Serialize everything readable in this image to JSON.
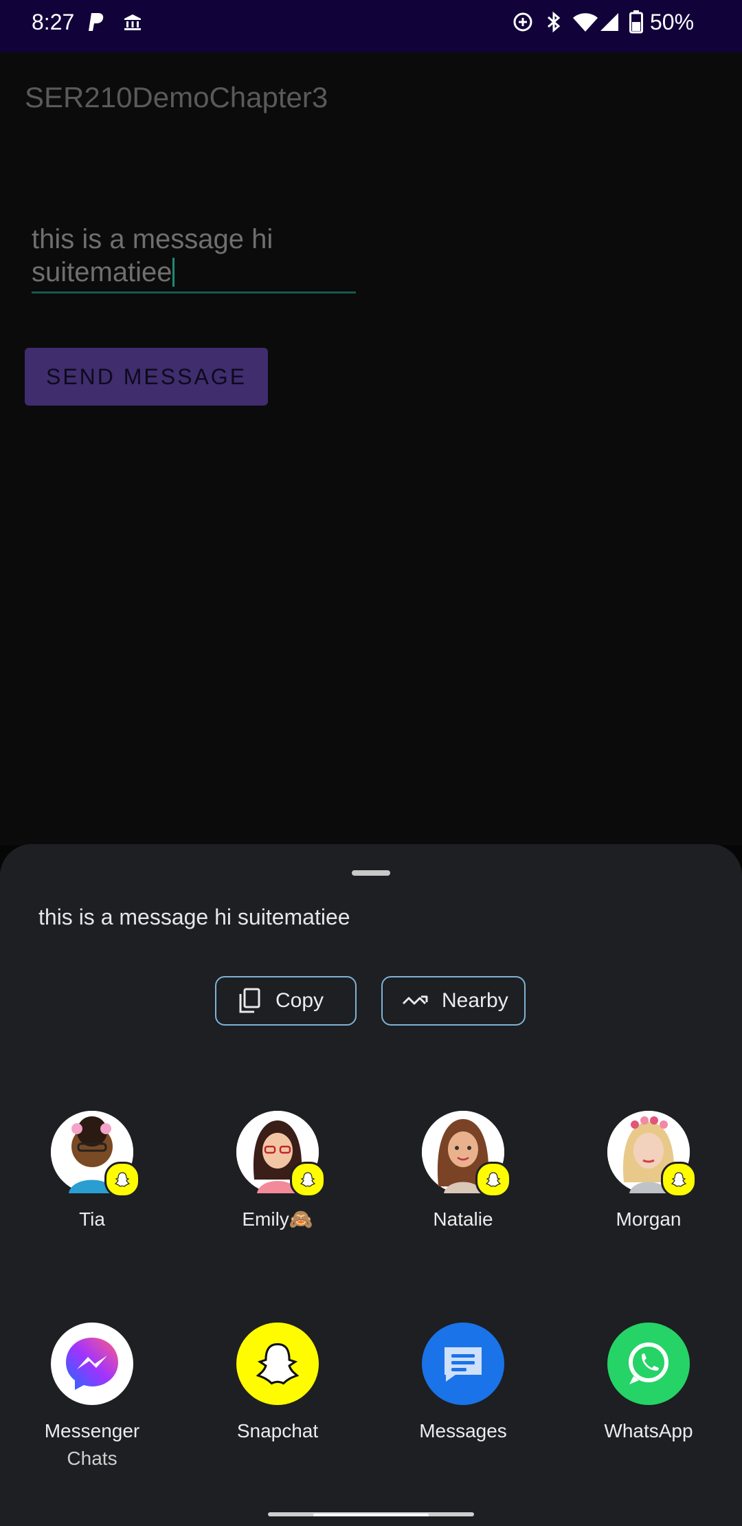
{
  "status_bar": {
    "time": "8:27",
    "battery": "50%",
    "icons": [
      "paypal-icon",
      "bank-icon",
      "data-saver-icon",
      "bluetooth-icon",
      "wifi-icon",
      "signal-icon",
      "battery-icon"
    ],
    "background": "#12023a"
  },
  "app": {
    "title": "SER210DemoChapter3",
    "message_field": {
      "line1": "this is a message hi",
      "line2": "suitematiee"
    },
    "send_button": "SEND MESSAGE",
    "accent": "#3f2d6e"
  },
  "share_sheet": {
    "text": "this is a message hi suitematiee",
    "actions": [
      {
        "label": "Copy",
        "icon": "copy-icon"
      },
      {
        "label": "Nearby",
        "icon": "nearby-share-icon"
      }
    ],
    "contacts": [
      {
        "name": "Tia",
        "app_badge": "snapchat-badge-icon"
      },
      {
        "name": "Emily🙈",
        "app_badge": "snapchat-badge-icon"
      },
      {
        "name": "Natalie",
        "app_badge": "snapchat-badge-icon"
      },
      {
        "name": "Morgan",
        "app_badge": "snapchat-badge-icon"
      }
    ],
    "apps": [
      {
        "line1": "Messenger",
        "line2": "Chats",
        "icon": "messenger-icon",
        "color": "#a033ff"
      },
      {
        "line1": "Snapchat",
        "line2": "",
        "icon": "snapchat-icon",
        "color": "#fffc00"
      },
      {
        "line1": "Messages",
        "line2": "",
        "icon": "messages-icon",
        "color": "#1a73e8"
      },
      {
        "line1": "WhatsApp",
        "line2": "",
        "icon": "whatsapp-icon",
        "color": "#25d366"
      }
    ]
  }
}
